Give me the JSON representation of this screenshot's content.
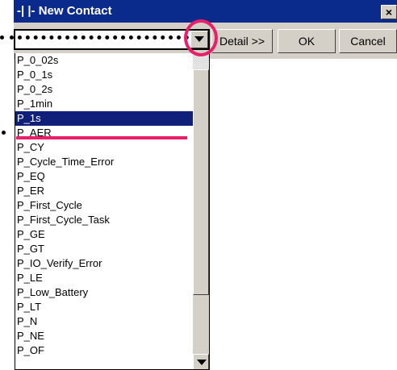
{
  "window": {
    "title": "-| |- New Contact",
    "close_label": "×"
  },
  "combo": {
    "value": "",
    "arrow_icon": "chevron-down-icon"
  },
  "buttons": {
    "detail_label": "Detail >>",
    "ok_label": "OK",
    "cancel_label": "Cancel"
  },
  "list": {
    "selected_index": 4,
    "items": [
      "P_0_02s",
      "P_0_1s",
      "P_0_2s",
      "P_1min",
      "P_1s",
      "P_AER",
      "P_CY",
      "P_Cycle_Time_Error",
      "P_EQ",
      "P_ER",
      "P_First_Cycle",
      "P_First_Cycle_Task",
      "P_GE",
      "P_GT",
      "P_IO_Verify_Error",
      "P_LE",
      "P_Low_Battery",
      "P_LT",
      "P_N",
      "P_NE",
      "P_OF"
    ]
  },
  "colors": {
    "title_bar": "#0a2a8c",
    "selection": "#10207a",
    "annotation": "#e8206a",
    "face": "#d4d0c8"
  }
}
